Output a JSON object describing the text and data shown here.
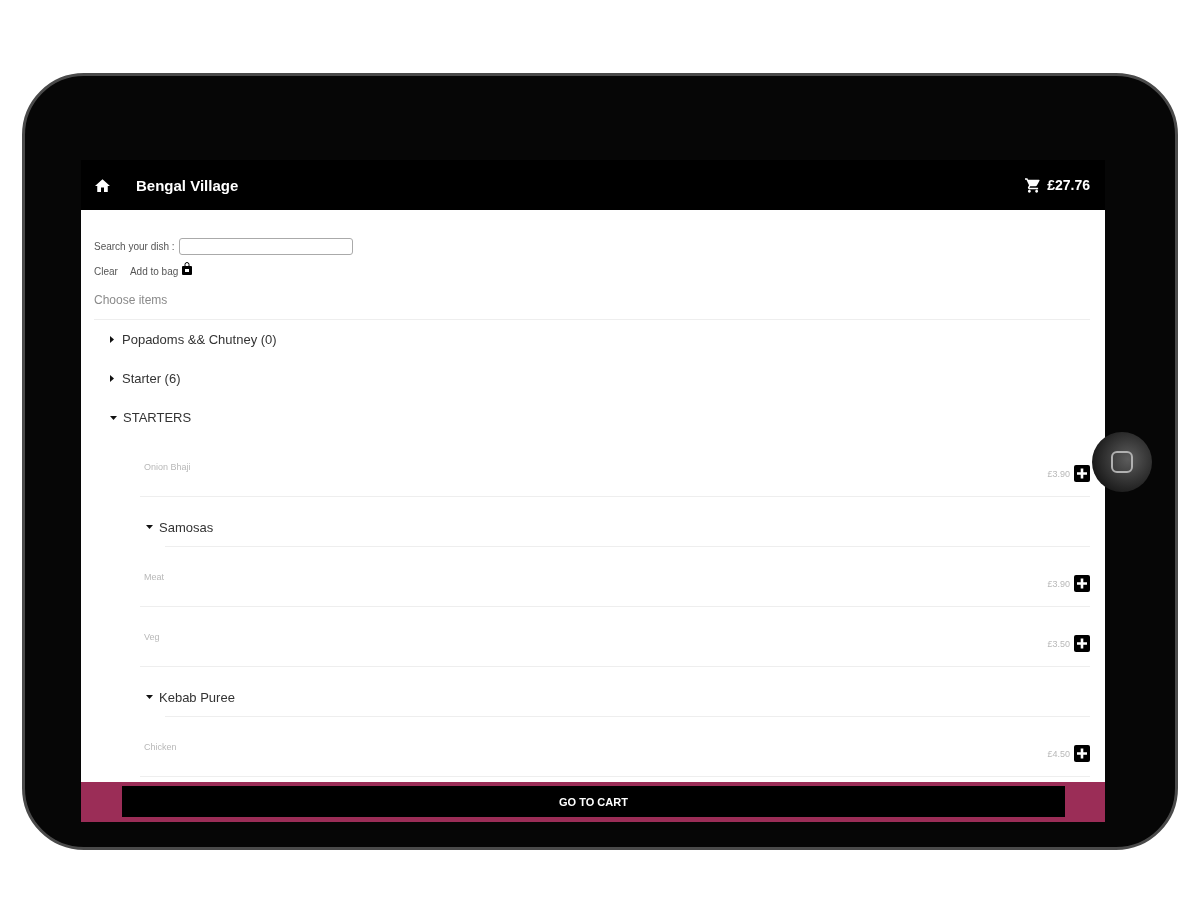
{
  "app_bar": {
    "title": "Bengal Village",
    "cart_total": "£27.76"
  },
  "search": {
    "label": "Search your dish :"
  },
  "actions": {
    "clear": "Clear",
    "add_to_bag": "Add to bag"
  },
  "section_title": "Choose items",
  "menu": [
    {
      "kind": "category",
      "label": "Popadoms && Chutney (0)",
      "expanded": false
    },
    {
      "kind": "category",
      "label": "Starter (6)",
      "expanded": false
    },
    {
      "kind": "category",
      "label": "STARTERS",
      "expanded": true,
      "children": [
        {
          "kind": "item",
          "name": "Onion Bhaji",
          "price": "£3.90"
        },
        {
          "kind": "group",
          "label": "Samosas",
          "expanded": true,
          "children": [
            {
              "kind": "item",
              "name": "Meat",
              "price": "£3.90"
            },
            {
              "kind": "item",
              "name": "Veg",
              "price": "£3.50"
            }
          ]
        },
        {
          "kind": "group",
          "label": "Kebab Puree",
          "expanded": true,
          "children": [
            {
              "kind": "item",
              "name": "Chicken",
              "price": "£4.50"
            }
          ]
        }
      ]
    }
  ],
  "footer": {
    "button": "GO TO CART"
  }
}
